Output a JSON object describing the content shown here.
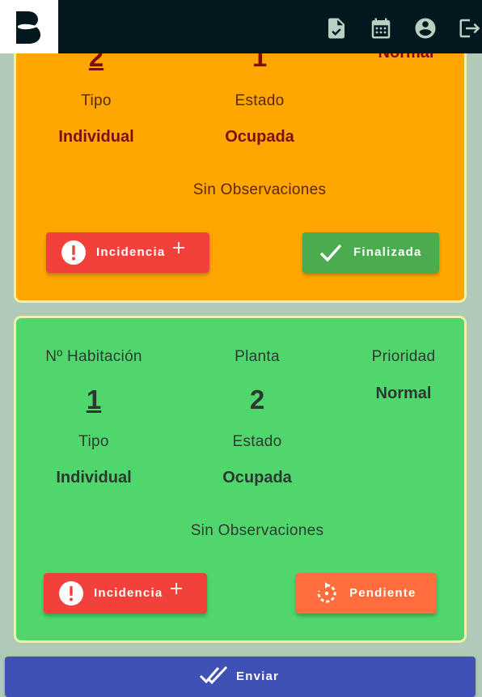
{
  "header": {
    "icons": [
      "logo-b-icon",
      "document-check-icon",
      "calendar-icon",
      "account-circle-icon",
      "logout-icon"
    ]
  },
  "room_cards": [
    {
      "color": "#ffa600",
      "room_number": "2",
      "floor": "1",
      "priority": "Normal",
      "type_label": "Tipo",
      "type_value": "Individual",
      "status_label": "Estado",
      "status_value": "Ocupada",
      "observations": "Sin Observaciones",
      "incident_button": "Incidencia",
      "action_button": "Finalizada",
      "action_color": "#4aac4e"
    },
    {
      "color": "#4fd66d",
      "room_label": "Nº Habitación",
      "floor_label": "Planta",
      "priority_label": "Prioridad",
      "room_number": "1",
      "floor": "2",
      "priority": "Normal",
      "type_label": "Tipo",
      "type_value": "Individual",
      "status_label": "Estado",
      "status_value": "Ocupada",
      "observations": "Sin Observaciones",
      "incident_button": "Incidencia",
      "action_button": "Pendiente",
      "action_color": "#ff6d3e"
    }
  ],
  "footer": {
    "send_label": "Enviar",
    "send_color": "#3f51b5"
  }
}
